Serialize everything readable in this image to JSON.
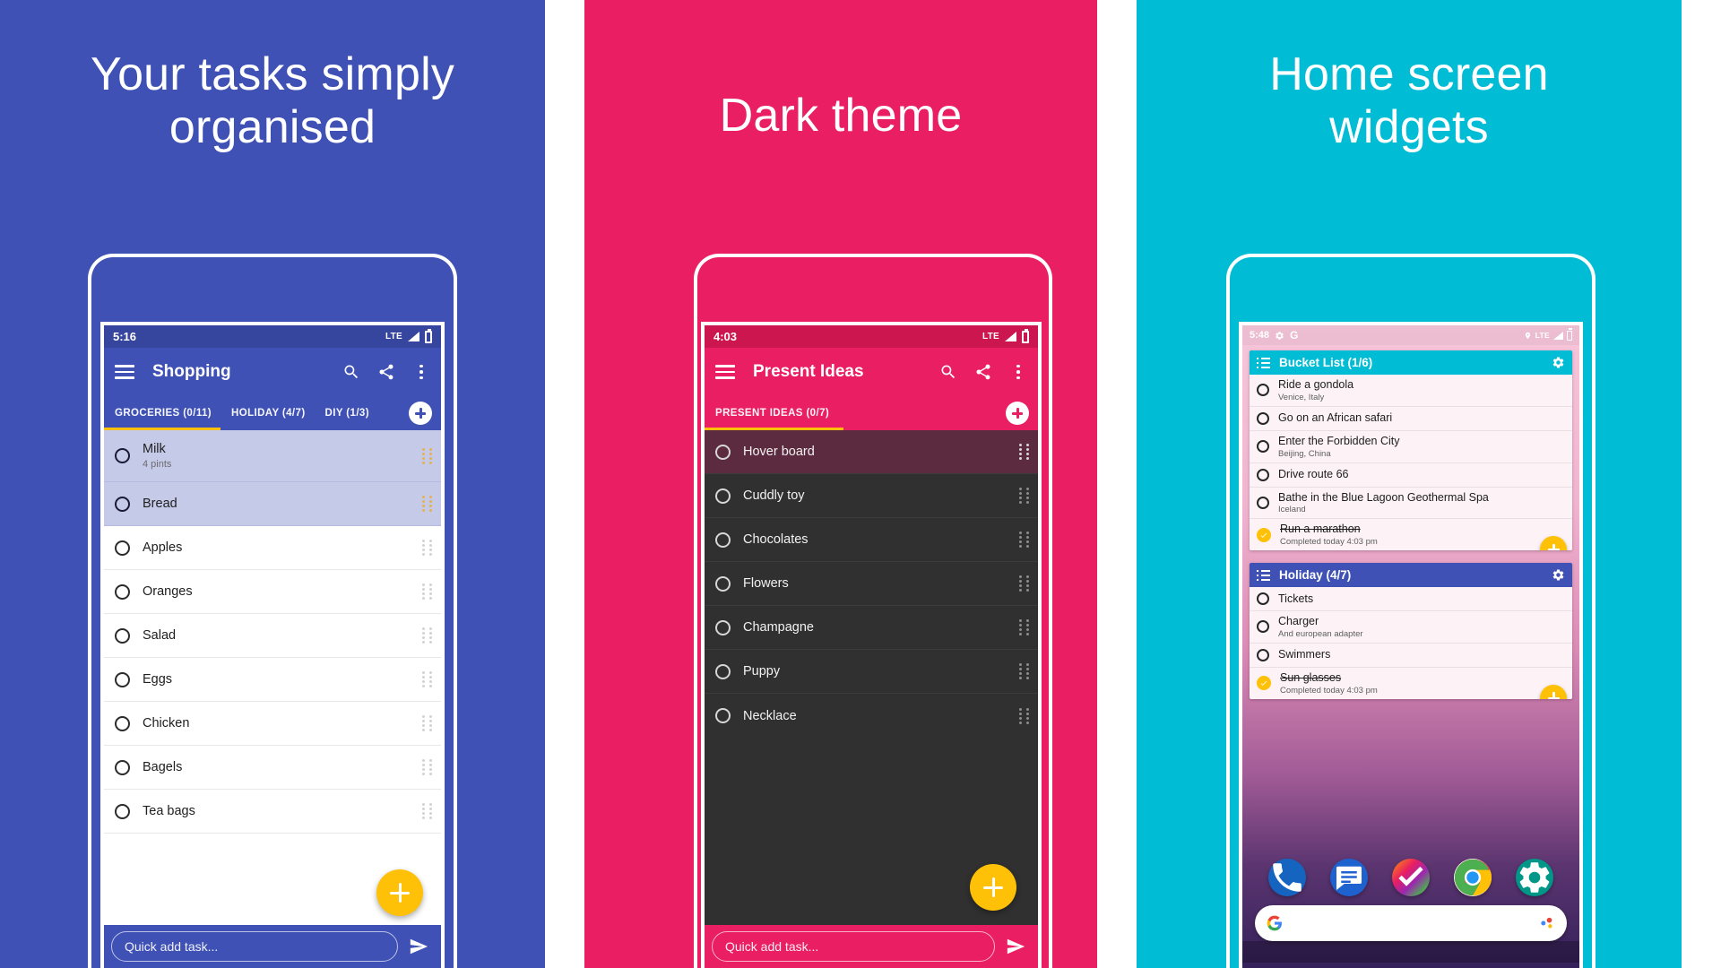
{
  "panels": [
    {
      "headline": "Your tasks simply\norganised",
      "bg": "#3f51b5",
      "status": {
        "time": "5:16",
        "network": "LTE"
      },
      "appbar": {
        "title": "Shopping",
        "menu_icon": "hamburger-icon",
        "search_icon": "search-icon",
        "share_icon": "share-icon",
        "overflow_icon": "more-vert-icon"
      },
      "tabs": [
        {
          "label": "GROCERIES (0/11)",
          "active": true
        },
        {
          "label": "HOLIDAY (4/7)",
          "active": false
        },
        {
          "label": "DIY (1/3)",
          "active": false
        }
      ],
      "add_tab_icon": "add-icon",
      "tasks": [
        {
          "title": "Milk",
          "subtitle": "4 pints",
          "selected": true,
          "done": false
        },
        {
          "title": "Bread",
          "subtitle": "",
          "selected": true,
          "done": false
        },
        {
          "title": "Apples",
          "subtitle": "",
          "selected": false,
          "done": false
        },
        {
          "title": "Oranges",
          "subtitle": "",
          "selected": false,
          "done": false
        },
        {
          "title": "Salad",
          "subtitle": "",
          "selected": false,
          "done": false
        },
        {
          "title": "Eggs",
          "subtitle": "",
          "selected": false,
          "done": false
        },
        {
          "title": "Chicken",
          "subtitle": "",
          "selected": false,
          "done": false
        },
        {
          "title": "Bagels",
          "subtitle": "",
          "selected": false,
          "done": false
        },
        {
          "title": "Tea bags",
          "subtitle": "",
          "selected": false,
          "done": false
        }
      ],
      "fab_icon": "add-icon",
      "quick_add": {
        "placeholder": "Quick add task...",
        "value": "",
        "send_icon": "send-icon"
      }
    },
    {
      "headline": "Dark theme",
      "bg": "#e91e63",
      "status": {
        "time": "4:03",
        "network": "LTE"
      },
      "appbar": {
        "title": "Present Ideas",
        "menu_icon": "hamburger-icon",
        "search_icon": "search-icon",
        "share_icon": "share-icon",
        "overflow_icon": "more-vert-icon"
      },
      "tabs": [
        {
          "label": "PRESENT IDEAS (0/7)",
          "active": true
        }
      ],
      "add_tab_icon": "add-icon",
      "tasks": [
        {
          "title": "Hover board",
          "selected": true
        },
        {
          "title": "Cuddly toy",
          "selected": false
        },
        {
          "title": "Chocolates",
          "selected": false
        },
        {
          "title": "Flowers",
          "selected": false
        },
        {
          "title": "Champagne",
          "selected": false
        },
        {
          "title": "Puppy",
          "selected": false
        },
        {
          "title": "Necklace",
          "selected": false
        }
      ],
      "fab_icon": "add-icon",
      "quick_add": {
        "placeholder": "Quick add task...",
        "value": "",
        "send_icon": "send-icon"
      }
    },
    {
      "headline": "Home screen\nwidgets",
      "bg": "#00bcd4",
      "status": {
        "time": "5:48",
        "network": "LTE",
        "gear_icon": "gear-icon",
        "google_icon": "google-g-icon",
        "location_icon": "location-pin-icon"
      },
      "widgets": [
        {
          "title": "Bucket List (1/6)",
          "accent": "#00bcd4",
          "list_icon": "list-icon",
          "settings_icon": "gear-icon",
          "fab_icon": "add-icon",
          "items": [
            {
              "title": "Ride a gondola",
              "subtitle": "Venice, Italy",
              "done": false
            },
            {
              "title": "Go on an African safari",
              "subtitle": "",
              "done": false
            },
            {
              "title": "Enter the Forbidden City",
              "subtitle": "Beijing, China",
              "done": false
            },
            {
              "title": "Drive route 66",
              "subtitle": "",
              "done": false
            },
            {
              "title": "Bathe in the Blue Lagoon Geothermal Spa",
              "subtitle": "Iceland",
              "done": false
            },
            {
              "title": "Run a marathon",
              "subtitle": "Completed today 4:03 pm",
              "done": true
            }
          ]
        },
        {
          "title": "Holiday (4/7)",
          "accent": "#3f51b5",
          "list_icon": "list-icon",
          "settings_icon": "gear-icon",
          "fab_icon": "add-icon",
          "items": [
            {
              "title": "Tickets",
              "subtitle": "",
              "done": false
            },
            {
              "title": "Charger",
              "subtitle": "And european adapter",
              "done": false
            },
            {
              "title": "Swimmers",
              "subtitle": "",
              "done": false
            },
            {
              "title": "Sun glasses",
              "subtitle": "Completed today 4:03 pm",
              "done": true
            }
          ]
        }
      ],
      "dock": [
        {
          "name": "phone-icon"
        },
        {
          "name": "messages-icon"
        },
        {
          "name": "tasks-check-icon"
        },
        {
          "name": "chrome-icon"
        },
        {
          "name": "settings-gear-icon"
        }
      ],
      "search": {
        "google_icon": "google-g-icon",
        "assistant_icon": "assistant-icon",
        "placeholder": ""
      }
    }
  ],
  "colors": {
    "indigo": "#3f51b5",
    "pink": "#e91e63",
    "cyan": "#00bcd4",
    "amber": "#ffc107",
    "dark_surface": "#303030",
    "dark_selected": "#5c2b3f",
    "selected_light": "#c5cae9"
  }
}
